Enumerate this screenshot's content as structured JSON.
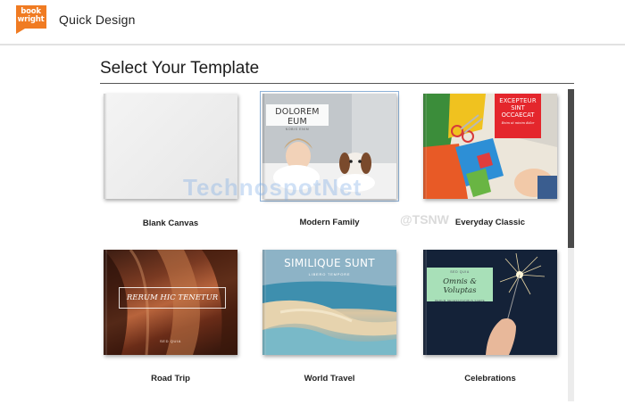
{
  "header": {
    "logo_text_line1": "book",
    "logo_text_line2": "wright",
    "app_title": "Quick Design"
  },
  "page": {
    "heading": "Select Your Template"
  },
  "templates": [
    {
      "label": "Blank Canvas"
    },
    {
      "label": "Modern Family",
      "cover_title": "DOLOREM EUM",
      "cover_subtitle": "NOBIS ENIM"
    },
    {
      "label": "Everyday Classic",
      "cover_title_line1": "EXCEPTEUR",
      "cover_title_line2": "SINT",
      "cover_title_line3": "OCCAECAT",
      "cover_subtitle": "Enim ut minim dolor"
    },
    {
      "label": "Road Trip",
      "cover_title": "RERUM HIC TENETUR",
      "cover_subtitle": "SED QUIA"
    },
    {
      "label": "World Travel",
      "cover_title": "SIMILIQUE SUNT",
      "cover_subtitle": "LIBERO TEMPORE"
    },
    {
      "label": "Celebrations",
      "cover_kicker": "SED QUIA",
      "cover_title": "Omnis & Voluptas",
      "cover_subtitle": "RERUM NECESSITATIBUS SAEPE"
    }
  ],
  "watermark": {
    "main": "TechnospotNet",
    "sub": "@TSNW"
  },
  "colors": {
    "brand": "#f07b22",
    "heading_rule": "#555555",
    "selected_border": "#8fb3d9",
    "scroll_thumb": "#4a4a4a"
  }
}
